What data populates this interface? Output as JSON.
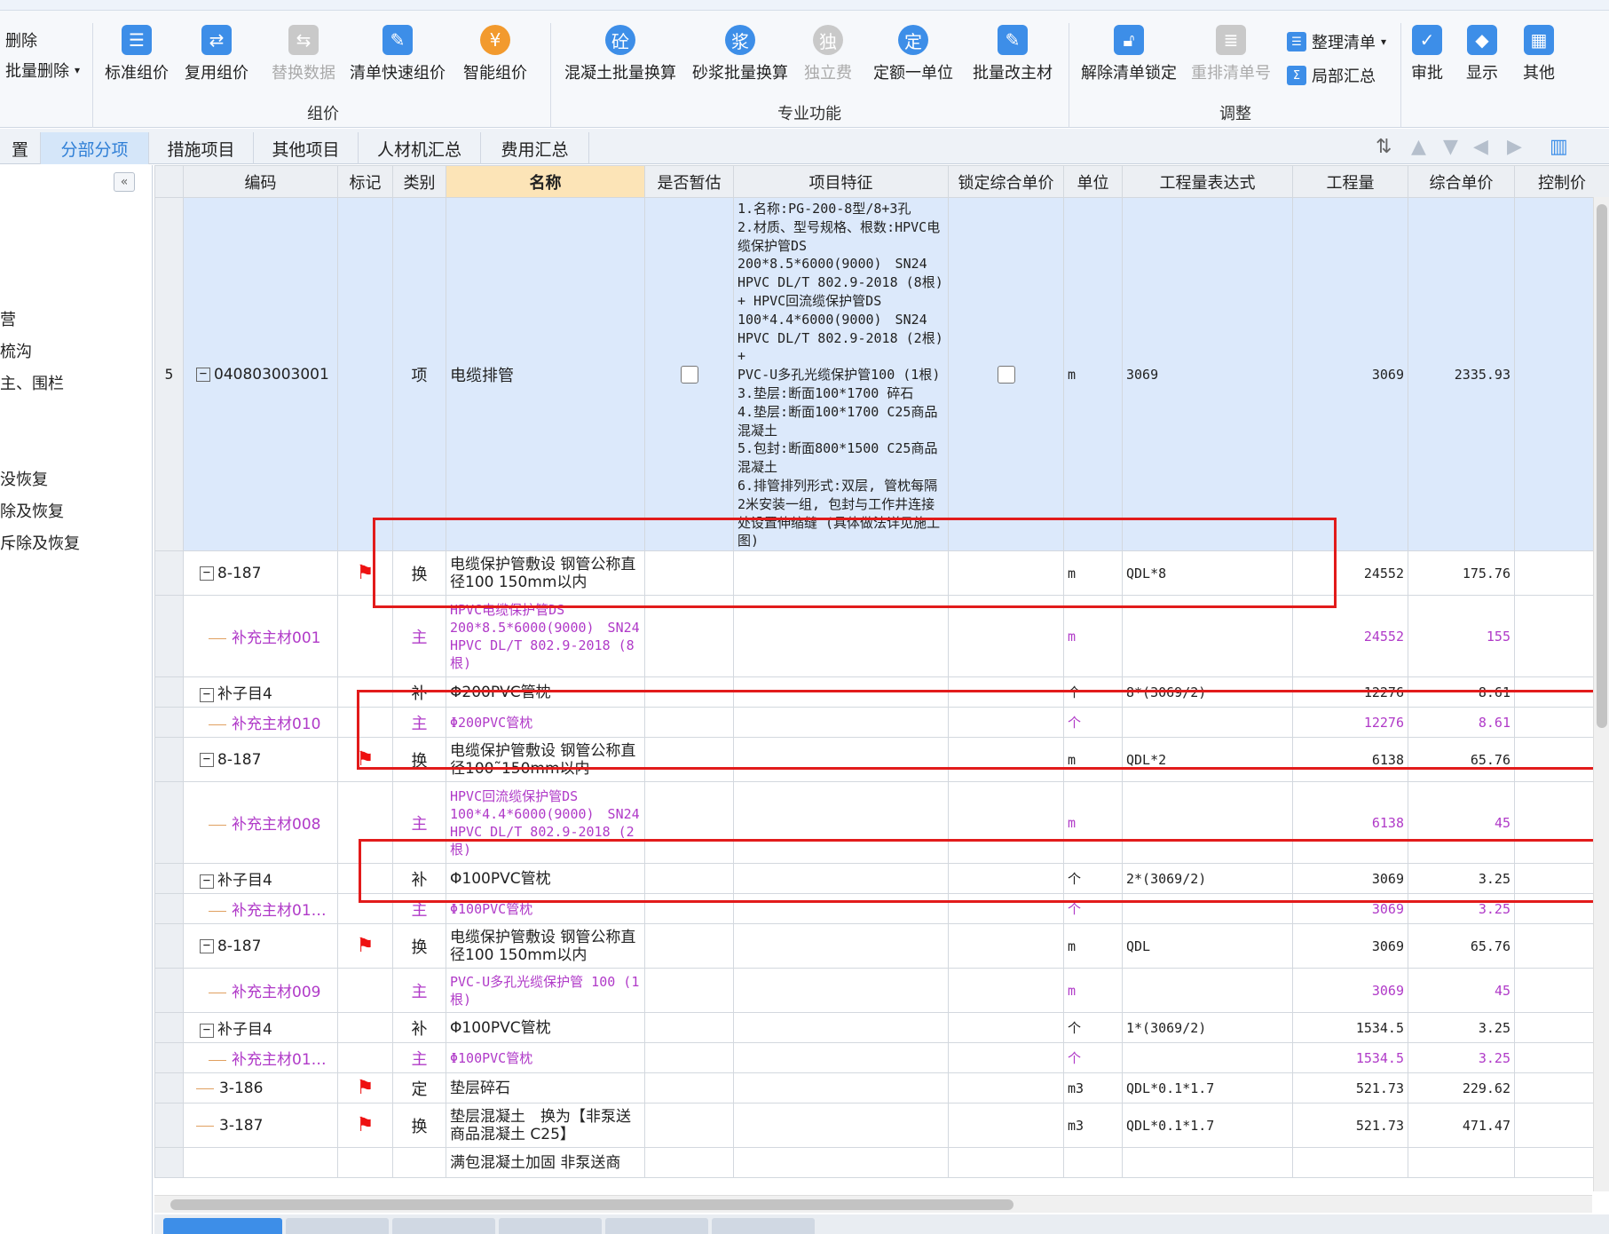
{
  "ribbon": {
    "delete_label": "删除",
    "batch_delete_label": "批量删除",
    "buttons": [
      {
        "label": "标准组价"
      },
      {
        "label": "复用组价"
      },
      {
        "label": "替换数据"
      },
      {
        "label": "清单快速组价"
      },
      {
        "label": "智能组价"
      },
      {
        "label": "混凝土批量换算"
      },
      {
        "label": "砂浆批量换算"
      },
      {
        "label": "独立费"
      },
      {
        "label": "定额一单位"
      },
      {
        "label": "批量改主材"
      },
      {
        "label": "解除清单锁定"
      },
      {
        "label": "重排清单号"
      },
      {
        "label": "审批"
      },
      {
        "label": "显示"
      },
      {
        "label": "其他"
      }
    ],
    "organize_list_label": "整理清单",
    "local_summary_label": "局部汇总",
    "groups": [
      "组价",
      "专业功能",
      "调整"
    ]
  },
  "tabs": [
    {
      "label": "置"
    },
    {
      "label": "分部分项"
    },
    {
      "label": "措施项目"
    },
    {
      "label": "其他项目"
    },
    {
      "label": "人材机汇总"
    },
    {
      "label": "费用汇总"
    }
  ],
  "left_tree": [
    {
      "label": "营"
    },
    {
      "label": "梳沟"
    },
    {
      "label": "主、围栏"
    },
    {
      "label": "没恢复"
    },
    {
      "label": "除及恢复"
    },
    {
      "label": "斥除及恢复"
    }
  ],
  "columns": [
    "编码",
    "标记",
    "类别",
    "名称",
    "是否暂估",
    "项目特征",
    "锁定综合单价",
    "单位",
    "工程量表达式",
    "工程量",
    "综合单价",
    "控制价"
  ],
  "parent_row": {
    "row_no": "5",
    "code": "040803003001",
    "type": "项",
    "name": "电缆排管",
    "feature": "1.名称:PG-200-8型/8+3孔\n2.材质、型号规格、根数:HPVC电缆保护管DS 200*8.5*6000(9000)　SN24 HPVC DL/T 802.9-2018 (8根) + HPVC回流缆保护管DS 100*4.4*6000(9000)　SN24 HPVC DL/T 802.9-2018 (2根) +\nPVC-U多孔光缆保护管100 (1根)\n3.垫层:断面100*1700 碎石\n4.垫层:断面100*1700 C25商品混凝土\n5.包封:断面800*1500 C25商品混凝土\n6.排管排列形式:双层, 管枕每隔2米安装一组, 包封与工作井连接处设置伸缩缝 (具体做法详见施工图)",
    "unit": "m",
    "expr": "3069",
    "qty": "3069",
    "price": "2335.93"
  },
  "rows": [
    {
      "code": "8-187",
      "type": "换",
      "name": "电缆保护管敷设 钢管公称直径100 150mm以内",
      "unit": "m",
      "expr": "QDL*8",
      "qty": "24552",
      "price": "175.76"
    },
    {
      "code": "补充主材001",
      "type": "主",
      "name": "HPVC电缆保护管DS 200*8.5*6000(9000)　SN24 HPVC DL/T 802.9-2018 (8根)",
      "unit": "m",
      "expr": "",
      "qty": "24552",
      "price": "155"
    },
    {
      "code": "补子目4",
      "type": "补",
      "name": "Φ200PVC管枕",
      "unit": "个",
      "expr": "8*(3069/2)",
      "qty": "12276",
      "price": "8.61"
    },
    {
      "code": "补充主材010",
      "type": "主",
      "name": "Φ200PVC管枕",
      "unit": "个",
      "expr": "",
      "qty": "12276",
      "price": "8.61"
    },
    {
      "code": "8-187",
      "type": "换",
      "name": "电缆保护管敷设 钢管公称直径100˜150mm以内",
      "unit": "m",
      "expr": "QDL*2",
      "qty": "6138",
      "price": "65.76"
    },
    {
      "code": "补充主材008",
      "type": "主",
      "name": "HPVC回流缆保护管DS 100*4.4*6000(9000)　SN24 HPVC DL/T 802.9-2018 (2根)",
      "unit": "m",
      "expr": "",
      "qty": "6138",
      "price": "45"
    },
    {
      "code": "补子目4",
      "type": "补",
      "name": "Φ100PVC管枕",
      "unit": "个",
      "expr": "2*(3069/2)",
      "qty": "3069",
      "price": "3.25"
    },
    {
      "code": "补充主材01…",
      "type": "主",
      "name": "Φ100PVC管枕",
      "unit": "个",
      "expr": "",
      "qty": "3069",
      "price": "3.25"
    },
    {
      "code": "8-187",
      "type": "换",
      "name": "电缆保护管敷设 钢管公称直径100 150mm以内",
      "unit": "m",
      "expr": "QDL",
      "qty": "3069",
      "price": "65.76"
    },
    {
      "code": "补充主材009",
      "type": "主",
      "name": "PVC-U多孔光缆保护管 100 (1根)",
      "unit": "m",
      "expr": "",
      "qty": "3069",
      "price": "45"
    },
    {
      "code": "补子目4",
      "type": "补",
      "name": "Φ100PVC管枕",
      "unit": "个",
      "expr": "1*(3069/2)",
      "qty": "1534.5",
      "price": "3.25"
    },
    {
      "code": "补充主材01…",
      "type": "主",
      "name": "Φ100PVC管枕",
      "unit": "个",
      "expr": "",
      "qty": "1534.5",
      "price": "3.25"
    },
    {
      "code": "3-186",
      "type": "定",
      "name": "垫层碎石",
      "unit": "m3",
      "expr": "QDL*0.1*1.7",
      "qty": "521.73",
      "price": "229.62"
    },
    {
      "code": "3-187",
      "type": "换",
      "name": "垫层混凝土　换为【非泵送商品混凝土 C25】",
      "unit": "m3",
      "expr": "QDL*0.1*1.7",
      "qty": "521.73",
      "price": "471.47"
    },
    {
      "code": "",
      "type": "",
      "name": "满包混凝土加固 非泵送商",
      "unit": "",
      "expr": "",
      "qty": "",
      "price": ""
    }
  ],
  "colors": {
    "accent": "#3d8ee8",
    "main_material": "#b03ac8",
    "highlight": "#e21b1b",
    "selected_row": "#dce9fb"
  }
}
